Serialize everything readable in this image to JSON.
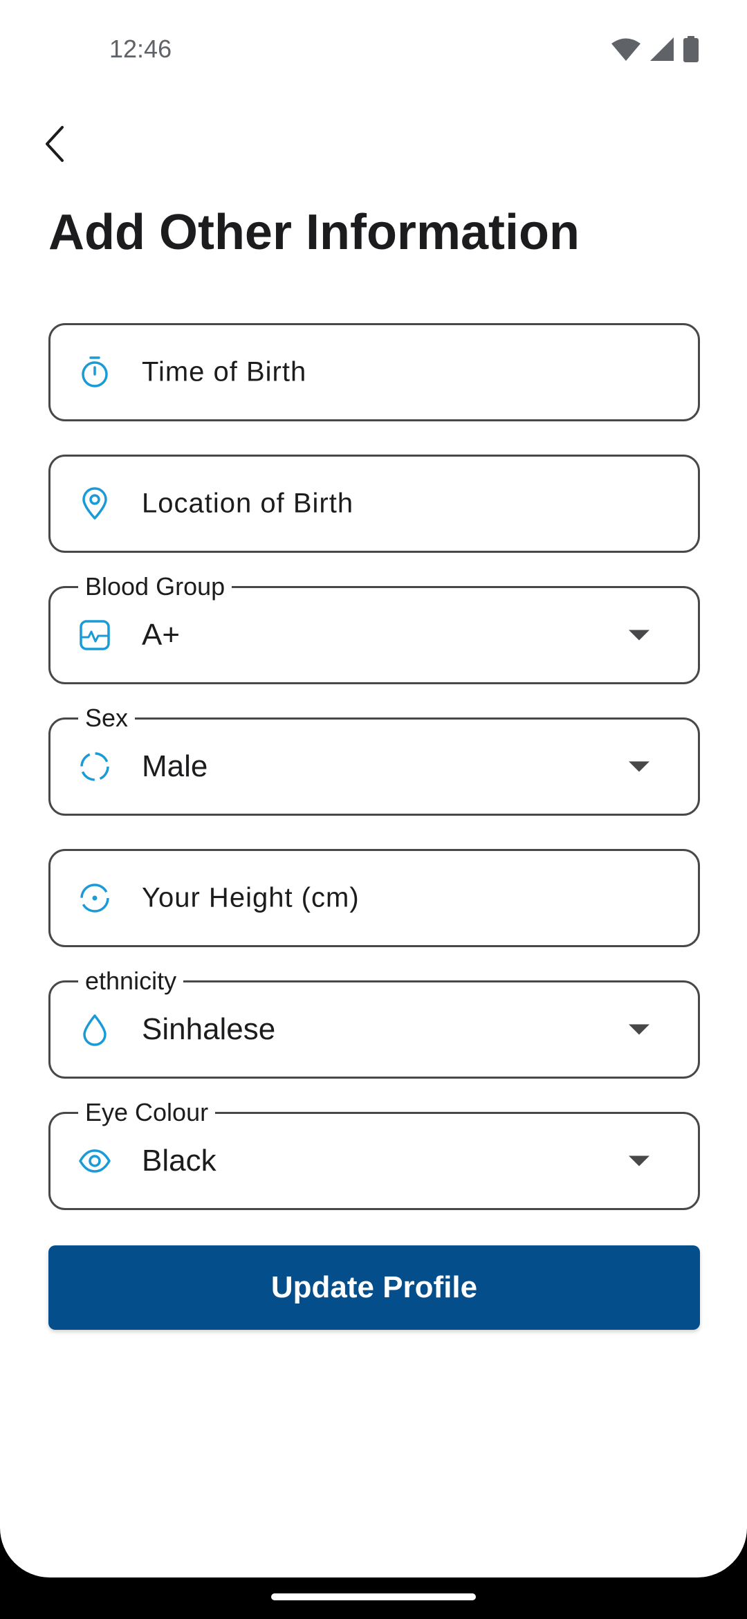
{
  "status_bar": {
    "time": "12:46",
    "icons": [
      "wifi-icon",
      "signal-icon",
      "battery-icon"
    ]
  },
  "header": {
    "back_icon": "chevron-left-icon",
    "title": "Add Other Information"
  },
  "form": {
    "time_of_birth": {
      "placeholder": "Time of Birth",
      "icon": "timer-icon"
    },
    "location_of_birth": {
      "placeholder": "Location of Birth",
      "icon": "location-pin-icon"
    },
    "blood_group": {
      "label": "Blood Group",
      "value": "A+",
      "icon": "heart-monitor-icon"
    },
    "sex": {
      "label": "Sex",
      "value": "Male",
      "icon": "dashed-circle-icon"
    },
    "height": {
      "placeholder": "Your Height (cm)",
      "icon": "target-circle-icon"
    },
    "ethnicity": {
      "label": "ethnicity",
      "value": "Sinhalese",
      "icon": "droplet-icon"
    },
    "eye_colour": {
      "label": "Eye Colour",
      "value": "Black",
      "icon": "eye-icon"
    }
  },
  "actions": {
    "update_label": "Update Profile"
  },
  "colors": {
    "accent_icon": "#1a9ad6",
    "primary_button": "#054e8c",
    "border": "#48484a"
  }
}
